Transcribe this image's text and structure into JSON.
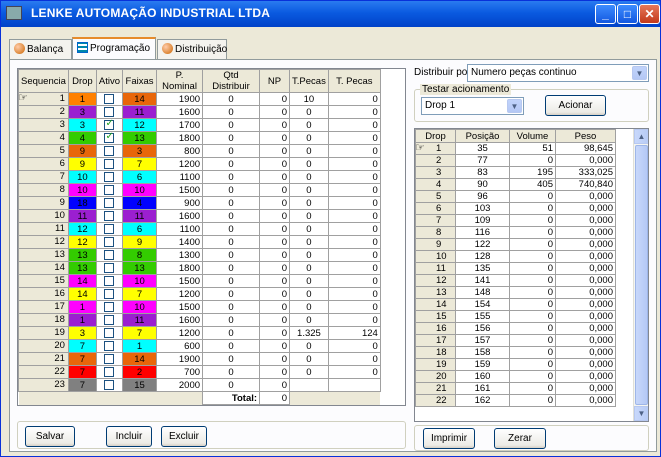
{
  "window": {
    "title": "LENKE AUTOMAÇÃO INDUSTRIAL LTDA"
  },
  "tabs": [
    {
      "label": "Balança",
      "icon": "globe-icon"
    },
    {
      "label": "Programação",
      "icon": "grid-icon"
    },
    {
      "label": "Distribuição",
      "icon": "globe-icon"
    }
  ],
  "left_grid": {
    "headers": [
      "Sequencia",
      "Drop",
      "Ativo",
      "Faixas",
      "P. Nominal",
      "Qtd Distribuir",
      "NP",
      "T.Pecas",
      "T. Pecas"
    ],
    "rows": [
      {
        "seq": "1",
        "drop": "1",
        "drop_color": "#ff8000",
        "ativo": false,
        "faixa": "14",
        "faixa_color": "#e8660a",
        "nominal": "1900",
        "qtd": "0",
        "np": "0",
        "tp1": "10",
        "tp2": "0"
      },
      {
        "seq": "2",
        "drop": "3",
        "drop_color": "#9b1fd0",
        "ativo": false,
        "faixa": "11",
        "faixa_color": "#9b1fd0",
        "nominal": "1600",
        "qtd": "0",
        "np": "0",
        "tp1": "0",
        "tp2": "0"
      },
      {
        "seq": "3",
        "drop": "3",
        "drop_color": "#00ffff",
        "ativo": true,
        "faixa": "12",
        "faixa_color": "#00ffff",
        "nominal": "1700",
        "qtd": "0",
        "np": "0",
        "tp1": "0",
        "tp2": "0"
      },
      {
        "seq": "4",
        "drop": "4",
        "drop_color": "#33cc00",
        "ativo": true,
        "faixa": "13",
        "faixa_color": "#33cc00",
        "nominal": "1800",
        "qtd": "0",
        "np": "0",
        "tp1": "0",
        "tp2": "0"
      },
      {
        "seq": "5",
        "drop": "9",
        "drop_color": "#e8660a",
        "ativo": false,
        "faixa": "3",
        "faixa_color": "#e8660a",
        "nominal": "800",
        "qtd": "0",
        "np": "0",
        "tp1": "0",
        "tp2": "0"
      },
      {
        "seq": "6",
        "drop": "9",
        "drop_color": "#ffff00",
        "ativo": false,
        "faixa": "7",
        "faixa_color": "#ffff00",
        "nominal": "1200",
        "qtd": "0",
        "np": "0",
        "tp1": "0",
        "tp2": "0"
      },
      {
        "seq": "7",
        "drop": "10",
        "drop_color": "#00ffff",
        "ativo": false,
        "faixa": "6",
        "faixa_color": "#00ffff",
        "nominal": "1100",
        "qtd": "0",
        "np": "0",
        "tp1": "0",
        "tp2": "0"
      },
      {
        "seq": "8",
        "drop": "10",
        "drop_color": "#ff00ff",
        "ativo": false,
        "faixa": "10",
        "faixa_color": "#ff00ff",
        "nominal": "1500",
        "qtd": "0",
        "np": "0",
        "tp1": "0",
        "tp2": "0"
      },
      {
        "seq": "9",
        "drop": "18",
        "drop_color": "#0000ff",
        "ativo": false,
        "faixa": "4",
        "faixa_color": "#0000ff",
        "nominal": "900",
        "qtd": "0",
        "np": "0",
        "tp1": "0",
        "tp2": "0"
      },
      {
        "seq": "10",
        "drop": "11",
        "drop_color": "#9b1fd0",
        "ativo": false,
        "faixa": "11",
        "faixa_color": "#9b1fd0",
        "nominal": "1600",
        "qtd": "0",
        "np": "0",
        "tp1": "0",
        "tp2": "0"
      },
      {
        "seq": "11",
        "drop": "12",
        "drop_color": "#00ffff",
        "ativo": false,
        "faixa": "6",
        "faixa_color": "#00ffff",
        "nominal": "1100",
        "qtd": "0",
        "np": "0",
        "tp1": "0",
        "tp2": "0"
      },
      {
        "seq": "12",
        "drop": "12",
        "drop_color": "#ffff00",
        "ativo": false,
        "faixa": "9",
        "faixa_color": "#ffff00",
        "nominal": "1400",
        "qtd": "0",
        "np": "0",
        "tp1": "0",
        "tp2": "0"
      },
      {
        "seq": "13",
        "drop": "13",
        "drop_color": "#33cc00",
        "ativo": false,
        "faixa": "8",
        "faixa_color": "#33cc00",
        "nominal": "1300",
        "qtd": "0",
        "np": "0",
        "tp1": "0",
        "tp2": "0"
      },
      {
        "seq": "14",
        "drop": "13",
        "drop_color": "#33cc00",
        "ativo": false,
        "faixa": "13",
        "faixa_color": "#33cc00",
        "nominal": "1800",
        "qtd": "0",
        "np": "0",
        "tp1": "0",
        "tp2": "0"
      },
      {
        "seq": "15",
        "drop": "14",
        "drop_color": "#ff00ff",
        "ativo": false,
        "faixa": "10",
        "faixa_color": "#ff00ff",
        "nominal": "1500",
        "qtd": "0",
        "np": "0",
        "tp1": "0",
        "tp2": "0"
      },
      {
        "seq": "16",
        "drop": "14",
        "drop_color": "#ffff00",
        "ativo": false,
        "faixa": "7",
        "faixa_color": "#ffff00",
        "nominal": "1200",
        "qtd": "0",
        "np": "0",
        "tp1": "0",
        "tp2": "0"
      },
      {
        "seq": "17",
        "drop": "1",
        "drop_color": "#ff00ff",
        "ativo": false,
        "faixa": "10",
        "faixa_color": "#ff00ff",
        "nominal": "1500",
        "qtd": "0",
        "np": "0",
        "tp1": "0",
        "tp2": "0"
      },
      {
        "seq": "18",
        "drop": "1",
        "drop_color": "#9b1fd0",
        "ativo": false,
        "faixa": "11",
        "faixa_color": "#9b1fd0",
        "nominal": "1600",
        "qtd": "0",
        "np": "0",
        "tp1": "0",
        "tp2": "0"
      },
      {
        "seq": "19",
        "drop": "3",
        "drop_color": "#ffff00",
        "ativo": false,
        "faixa": "7",
        "faixa_color": "#ffff00",
        "nominal": "1200",
        "qtd": "0",
        "np": "0",
        "tp1": "1.325",
        "tp2": "124"
      },
      {
        "seq": "20",
        "drop": "7",
        "drop_color": "#00ffff",
        "ativo": false,
        "faixa": "1",
        "faixa_color": "#00ffff",
        "nominal": "600",
        "qtd": "0",
        "np": "0",
        "tp1": "0",
        "tp2": "0"
      },
      {
        "seq": "21",
        "drop": "7",
        "drop_color": "#e8660a",
        "ativo": false,
        "faixa": "14",
        "faixa_color": "#e8660a",
        "nominal": "1900",
        "qtd": "0",
        "np": "0",
        "tp1": "0",
        "tp2": "0"
      },
      {
        "seq": "22",
        "drop": "7",
        "drop_color": "#ff0000",
        "ativo": false,
        "faixa": "2",
        "faixa_color": "#ff0000",
        "nominal": "700",
        "qtd": "0",
        "np": "0",
        "tp1": "0",
        "tp2": "0"
      },
      {
        "seq": "23",
        "drop": "7",
        "drop_color": "#808080",
        "ativo": false,
        "faixa": "15",
        "faixa_color": "#808080",
        "nominal": "2000",
        "qtd": "0",
        "np": "0",
        "tp1": "",
        "tp2": ""
      }
    ],
    "total_label": "Total:",
    "total_np": "0"
  },
  "buttons": {
    "salvar": "Salvar",
    "incluir": "Incluir",
    "excluir": "Excluir",
    "imprimir": "Imprimir",
    "zerar": "Zerar",
    "acionar": "Acionar"
  },
  "distribuir": {
    "label": "Distribuir por:",
    "value": "Numero peças continuo"
  },
  "testar": {
    "label": "Testar acionamento",
    "value": "Drop 1"
  },
  "right_grid": {
    "headers": [
      "Drop",
      "Posição",
      "Volume",
      "Peso"
    ],
    "rows": [
      [
        "1",
        "35",
        "51",
        "98,645"
      ],
      [
        "2",
        "77",
        "0",
        "0,000"
      ],
      [
        "3",
        "83",
        "195",
        "333,025"
      ],
      [
        "4",
        "90",
        "405",
        "740,840"
      ],
      [
        "5",
        "96",
        "0",
        "0,000"
      ],
      [
        "6",
        "103",
        "0",
        "0,000"
      ],
      [
        "7",
        "109",
        "0",
        "0,000"
      ],
      [
        "8",
        "116",
        "0",
        "0,000"
      ],
      [
        "9",
        "122",
        "0",
        "0,000"
      ],
      [
        "10",
        "128",
        "0",
        "0,000"
      ],
      [
        "11",
        "135",
        "0",
        "0,000"
      ],
      [
        "12",
        "141",
        "0",
        "0,000"
      ],
      [
        "13",
        "148",
        "0",
        "0,000"
      ],
      [
        "14",
        "154",
        "0",
        "0,000"
      ],
      [
        "15",
        "155",
        "0",
        "0,000"
      ],
      [
        "16",
        "156",
        "0",
        "0,000"
      ],
      [
        "17",
        "157",
        "0",
        "0,000"
      ],
      [
        "18",
        "158",
        "0",
        "0,000"
      ],
      [
        "19",
        "159",
        "0",
        "0,000"
      ],
      [
        "20",
        "160",
        "0",
        "0,000"
      ],
      [
        "21",
        "161",
        "0",
        "0,000"
      ],
      [
        "22",
        "162",
        "0",
        "0,000"
      ]
    ]
  }
}
